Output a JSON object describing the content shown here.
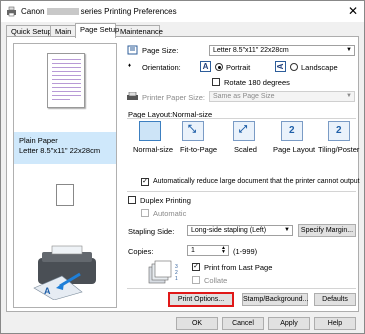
{
  "window": {
    "title_prefix": "Canon",
    "title_suffix": "series Printing Preferences",
    "close": "✕"
  },
  "tabs": [
    {
      "label": "Quick Setup"
    },
    {
      "label": "Main"
    },
    {
      "label": "Page Setup"
    },
    {
      "label": "Maintenance"
    }
  ],
  "preview": {
    "paper_type": "Plain Paper",
    "paper_size": "Letter 8.5\"x11\" 22x28cm"
  },
  "page_size": {
    "label": "Page Size:",
    "value": "Letter 8.5\"x11\" 22x28cm"
  },
  "orientation": {
    "label": "Orientation:",
    "portrait": "Portrait",
    "landscape": "Landscape",
    "icon_letter": "A",
    "rotate": "Rotate 180 degrees"
  },
  "printer_paper_size": {
    "label": "Printer Paper Size:",
    "value": "Same as Page Size"
  },
  "page_layout": {
    "label": "Page Layout:Normal-size",
    "options": [
      "Normal-size",
      "Fit-to-Page",
      "Scaled",
      "Page Layout",
      "Tiling/Poster"
    ],
    "page_layout_icon": "2",
    "tiling_icon": "2"
  },
  "auto_reduce": "Automatically reduce large document that the printer cannot output",
  "duplex": {
    "label": "Duplex Printing",
    "automatic": "Automatic"
  },
  "stapling": {
    "label": "Stapling Side:",
    "value": "Long-side stapling (Left)",
    "margin_button": "Specify Margin..."
  },
  "copies": {
    "label": "Copies:",
    "value": "1",
    "range": "(1-999)",
    "last_page": "Print from Last Page",
    "collate": "Collate"
  },
  "buttons": {
    "print_options": "Print Options...",
    "stamp": "Stamp/Background...",
    "defaults": "Defaults"
  },
  "footer": {
    "ok": "OK",
    "cancel": "Cancel",
    "apply": "Apply",
    "help": "Help"
  },
  "check": "✓"
}
